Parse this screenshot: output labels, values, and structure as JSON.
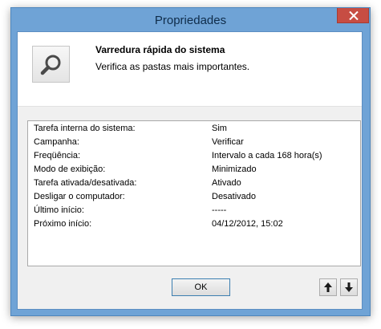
{
  "window": {
    "title": "Propriedades"
  },
  "header": {
    "task_title": "Varredura rápida do sistema",
    "task_description": "Verifica as pastas mais importantes.",
    "icon": "search-icon"
  },
  "properties": [
    {
      "label": "Tarefa interna do sistema:",
      "value": "Sim"
    },
    {
      "label": "Campanha:",
      "value": "Verificar"
    },
    {
      "label": "Freqüência:",
      "value": "Intervalo a cada 168 hora(s)"
    },
    {
      "label": "Modo de exibição:",
      "value": "Minimizado"
    },
    {
      "label": "Tarefa ativada/desativada:",
      "value": "Ativado"
    },
    {
      "label": "Desligar o computador:",
      "value": "Desativado"
    },
    {
      "label": "Último início:",
      "value": "-----"
    },
    {
      "label": "Próximo início:",
      "value": "04/12/2012, 15:02"
    }
  ],
  "buttons": {
    "ok_label": "OK",
    "up_icon": "arrow-up-icon",
    "down_icon": "arrow-down-icon",
    "close_icon": "close-icon"
  },
  "colors": {
    "frame": "#6fa3d6",
    "close_button": "#c74d43",
    "client_background": "#f0f0f0"
  }
}
